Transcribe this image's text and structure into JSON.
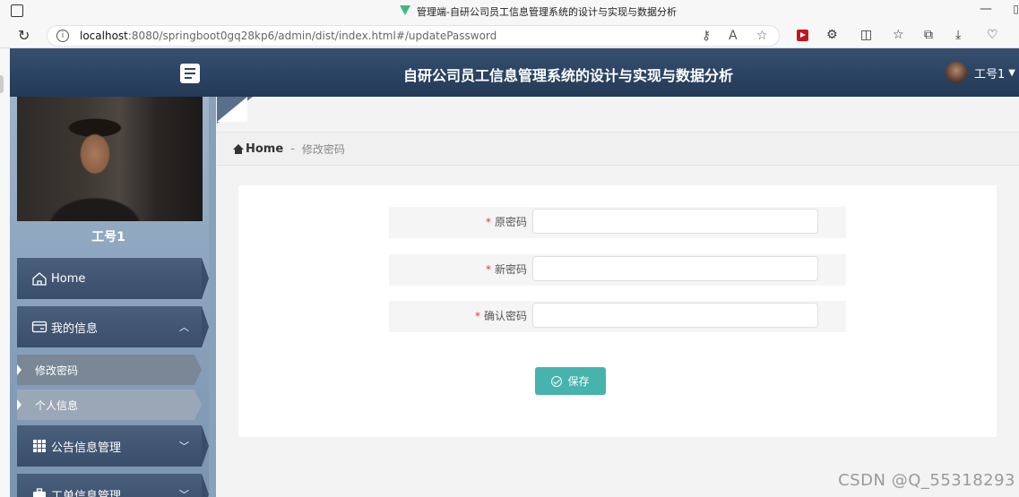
{
  "browser": {
    "tab_title": "管理端-自研公司员工信息管理系统的设计与实现与数据分析",
    "url_host": "localhost",
    "url_path": ":8080/springboot0gq28kp6/admin/dist/index.html#/updatePassword"
  },
  "header": {
    "app_title": "自研公司员工信息管理系统的设计与实现与数据分析",
    "user_name": "工号1"
  },
  "sidebar": {
    "username": "工号1",
    "items": [
      {
        "label": "Home"
      },
      {
        "label": "我的信息"
      },
      {
        "label": "公告信息管理"
      },
      {
        "label": "工单信息管理"
      }
    ],
    "sub_items": [
      {
        "label": "修改密码"
      },
      {
        "label": "个人信息"
      }
    ]
  },
  "breadcrumb": {
    "home": "Home",
    "separator": "-",
    "current": "修改密码"
  },
  "form": {
    "fields": [
      {
        "label": "原密码",
        "required_mark": "*",
        "value": ""
      },
      {
        "label": "新密码",
        "required_mark": "*",
        "value": ""
      },
      {
        "label": "确认密码",
        "required_mark": "*",
        "value": ""
      }
    ],
    "save_label": "保存"
  },
  "watermark": "CSDN @Q_55318293",
  "colors": {
    "header_bg": "#2c4463",
    "sidebar_item_bg": "#394e6a",
    "save_button": "#46b3ad",
    "required_star": "#e4393c"
  }
}
